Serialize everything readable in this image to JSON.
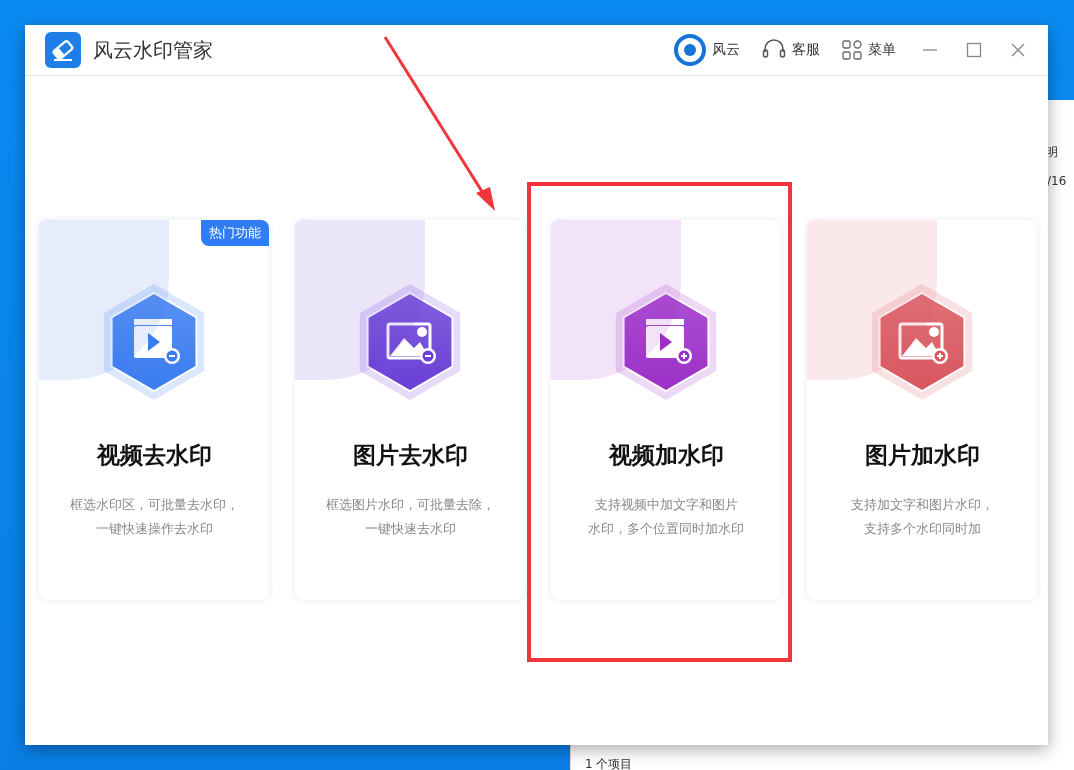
{
  "background_window": {
    "column_header": "明",
    "date_fragment": "/16",
    "status_text": "1 个项目"
  },
  "window": {
    "title": "风云水印管家",
    "header_links": [
      {
        "kind": "brand",
        "label": "风云"
      },
      {
        "kind": "support",
        "label": "客服"
      },
      {
        "kind": "menu",
        "label": "菜单"
      }
    ]
  },
  "cards": [
    {
      "kind": "video",
      "plus_mark": false,
      "color": "#3a7bf0",
      "title": "视频去水印",
      "description": [
        "框选水印区，可批量去水印，",
        "一键快速操作去水印"
      ],
      "badge": "热门功能",
      "highlighted": false
    },
    {
      "kind": "image",
      "plus_mark": false,
      "color": "#6a3fd6",
      "title": "图片去水印",
      "description": [
        "框选图片水印，可批量去除，",
        "一键快速去水印"
      ],
      "highlighted": false
    },
    {
      "kind": "video",
      "plus_mark": true,
      "color": "#9b2fc8",
      "title": "视频加水印",
      "description": [
        "支持视频中加文字和图片",
        "水印，多个位置同时加水印"
      ],
      "highlighted": true
    },
    {
      "kind": "image",
      "plus_mark": true,
      "color": "#d9565e",
      "title": "图片加水印",
      "description": [
        "支持加文字和图片水印，",
        "支持多个水印同时加"
      ],
      "highlighted": false
    }
  ]
}
